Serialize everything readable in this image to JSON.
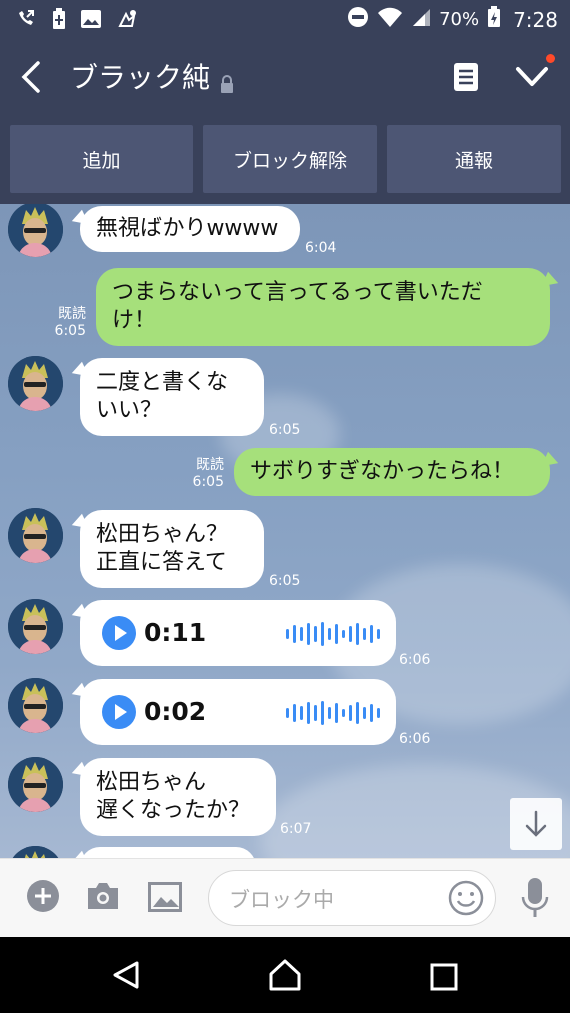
{
  "status_bar": {
    "battery": "70%",
    "time": "7:28",
    "left_icons": [
      "call-forward-icon",
      "battery-saver-icon",
      "image-notification-icon",
      "gesture-icon"
    ],
    "right_icons": [
      "do-not-disturb-icon",
      "wifi-icon",
      "signal-icon",
      "battery-charging-icon"
    ]
  },
  "header": {
    "title": "ブラック純",
    "icons": [
      "back-arrow-icon",
      "lock-icon",
      "note-icon",
      "chevron-down-icon"
    ]
  },
  "actions": [
    {
      "label": "追加"
    },
    {
      "label": "ブロック解除"
    },
    {
      "label": "通報"
    }
  ],
  "messages": [
    {
      "type": "in",
      "text": "無視ばかりwwww",
      "time": "6:04"
    },
    {
      "type": "out",
      "line1": "つまらないって言ってるって書いただ",
      "line2": "け！",
      "read": "既読",
      "time": "6:05"
    },
    {
      "type": "in",
      "line1": "二度と書くな",
      "line2": "いい？",
      "time": "6:05"
    },
    {
      "type": "out",
      "text": "サボりすぎなかったらね！",
      "read": "既読",
      "time": "6:05"
    },
    {
      "type": "in",
      "line1": "松田ちゃん？",
      "line2": "正直に答えて",
      "time": "6:05"
    },
    {
      "type": "voice",
      "duration": "0:11",
      "time": "6:06"
    },
    {
      "type": "voice",
      "duration": "0:02",
      "time": "6:06"
    },
    {
      "type": "in",
      "line1": "松田ちゃん",
      "line2": "遅くなったか？",
      "time": "6:07"
    }
  ],
  "input": {
    "placeholder": "ブロック中",
    "icons": [
      "plus-icon",
      "camera-icon",
      "image-icon",
      "emoji-icon",
      "microphone-icon"
    ]
  },
  "colors": {
    "header_bg": "#39415a",
    "button_bg": "#4d5674",
    "bubble_out": "#a6e07b",
    "play_blue": "#3a8cf5"
  }
}
